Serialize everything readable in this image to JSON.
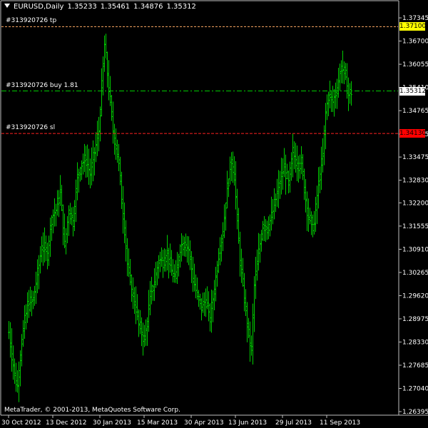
{
  "header": {
    "symbol": "EURUSD,Daily",
    "open": "1.35233",
    "high": "1.35461",
    "low": "1.34876",
    "close": "1.35312"
  },
  "levels": {
    "tp": {
      "label": "#313920726 tp",
      "price": 1.371,
      "price_text": "1.37100",
      "color": "#ffaa66",
      "tag_color": "#ffff00"
    },
    "buy": {
      "label": "#313920726 buy 1.81",
      "price": 1.35312,
      "price_text": "1.35312",
      "color": "#00cc00",
      "tag_color": "#ffffff"
    },
    "sl": {
      "label": "#313920726 sl",
      "price": 1.3413,
      "price_text": "1.34130",
      "color": "#ff2020",
      "tag_color": "#ff0000"
    }
  },
  "copyright": "MetaTrader, © 2001-2013, MetaQuotes Software Corp.",
  "colors": {
    "background": "#000000",
    "bars": "#00cc00",
    "axis": "#c0c0c0",
    "text": "#ffffff"
  },
  "chart_data": {
    "type": "ohlc",
    "symbol": "EURUSD",
    "timeframe": "Daily",
    "ylim": [
      1.26395,
      1.37505
    ],
    "yticks": [
      "1.37345",
      "1.36700",
      "1.36055",
      "1.35410",
      "1.34765",
      "1.34115",
      "1.33475",
      "1.32830",
      "1.32200",
      "1.31555",
      "1.30910",
      "1.30265",
      "1.29620",
      "1.28975",
      "1.28330",
      "1.27685",
      "1.27040",
      "1.26395"
    ],
    "xticks": [
      "30 Oct 2012",
      "13 Dec 2012",
      "30 Jan 2013",
      "15 Mar 2013",
      "30 Apr 2013",
      "13 Jun 2013",
      "29 Jul 2013",
      "11 Sep 2013"
    ],
    "xtick_bar_index": [
      0,
      31,
      64,
      95,
      128,
      159,
      192,
      223
    ],
    "close_path": [
      [
        0,
        1.286
      ],
      [
        4,
        1.274
      ],
      [
        6,
        1.271
      ],
      [
        9,
        1.284
      ],
      [
        13,
        1.2935
      ],
      [
        17,
        1.295
      ],
      [
        20,
        1.302
      ],
      [
        23,
        1.31
      ],
      [
        27,
        1.308
      ],
      [
        30,
        1.318
      ],
      [
        33,
        1.32
      ],
      [
        36,
        1.325
      ],
      [
        39,
        1.31
      ],
      [
        42,
        1.32
      ],
      [
        45,
        1.317
      ],
      [
        48,
        1.329
      ],
      [
        51,
        1.333
      ],
      [
        54,
        1.334
      ],
      [
        57,
        1.33
      ],
      [
        60,
        1.336
      ],
      [
        63,
        1.342
      ],
      [
        66,
        1.36
      ],
      [
        67,
        1.366
      ],
      [
        69,
        1.358
      ],
      [
        71,
        1.35
      ],
      [
        73,
        1.342
      ],
      [
        75,
        1.338
      ],
      [
        77,
        1.333
      ],
      [
        79,
        1.323
      ],
      [
        81,
        1.315
      ],
      [
        83,
        1.305
      ],
      [
        85,
        1.3
      ],
      [
        87,
        1.296
      ],
      [
        89,
        1.293
      ],
      [
        91,
        1.288
      ],
      [
        93,
        1.286
      ],
      [
        95,
        1.284
      ],
      [
        97,
        1.289
      ],
      [
        99,
        1.296
      ],
      [
        102,
        1.3
      ],
      [
        105,
        1.306
      ],
      [
        108,
        1.306
      ],
      [
        111,
        1.308
      ],
      [
        114,
        1.303
      ],
      [
        117,
        1.301
      ],
      [
        120,
        1.31
      ],
      [
        123,
        1.311
      ],
      [
        126,
        1.309
      ],
      [
        129,
        1.301
      ],
      [
        132,
        1.296
      ],
      [
        135,
        1.293
      ],
      [
        138,
        1.295
      ],
      [
        141,
        1.29
      ],
      [
        144,
        1.298
      ],
      [
        147,
        1.308
      ],
      [
        150,
        1.314
      ],
      [
        153,
        1.326
      ],
      [
        156,
        1.334
      ],
      [
        158,
        1.33
      ],
      [
        160,
        1.317
      ],
      [
        162,
        1.306
      ],
      [
        164,
        1.299
      ],
      [
        166,
        1.292
      ],
      [
        168,
        1.285
      ],
      [
        170,
        1.281
      ],
      [
        172,
        1.299
      ],
      [
        175,
        1.308
      ],
      [
        178,
        1.316
      ],
      [
        181,
        1.315
      ],
      [
        184,
        1.318
      ],
      [
        187,
        1.323
      ],
      [
        190,
        1.328
      ],
      [
        193,
        1.332
      ],
      [
        196,
        1.327
      ],
      [
        199,
        1.336
      ],
      [
        202,
        1.333
      ],
      [
        205,
        1.333
      ],
      [
        208,
        1.323
      ],
      [
        210,
        1.318
      ],
      [
        212,
        1.316
      ],
      [
        214,
        1.316
      ],
      [
        216,
        1.324
      ],
      [
        218,
        1.33
      ],
      [
        220,
        1.335
      ],
      [
        222,
        1.347
      ],
      [
        224,
        1.352
      ],
      [
        227,
        1.35
      ],
      [
        230,
        1.354
      ],
      [
        233,
        1.36
      ],
      [
        236,
        1.357
      ],
      [
        238,
        1.352
      ],
      [
        240,
        1.353
      ]
    ]
  }
}
